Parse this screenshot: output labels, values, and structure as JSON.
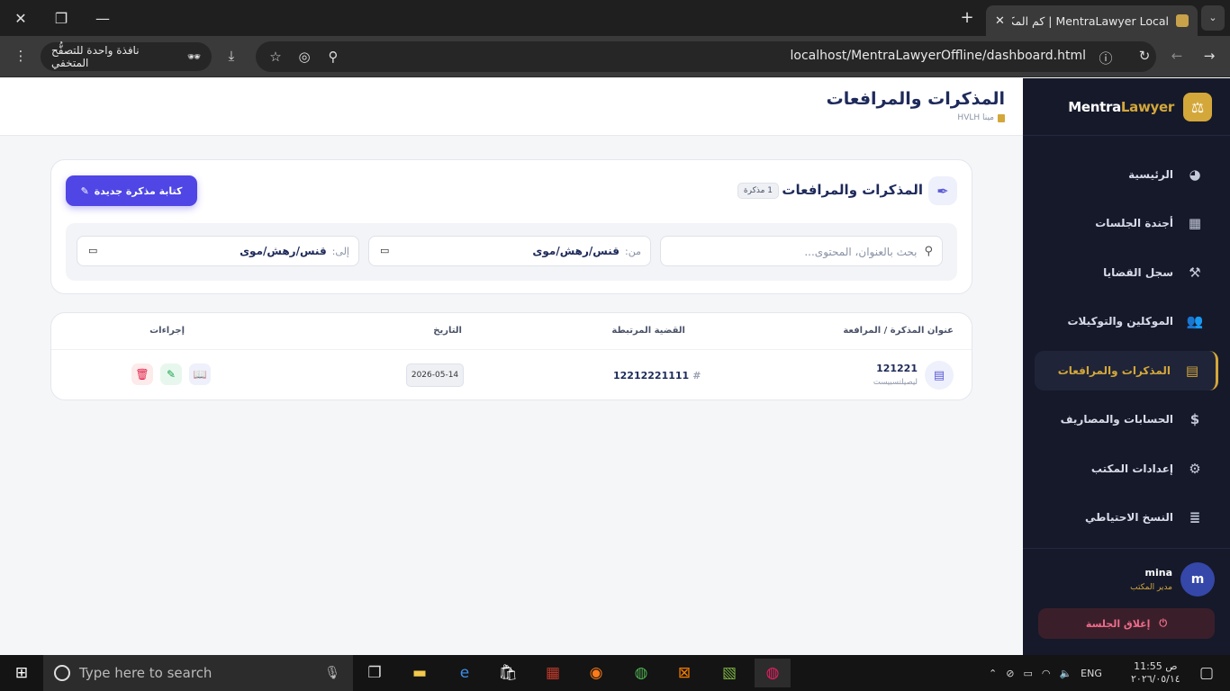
{
  "browser": {
    "tab_title": "MentraLawyer Local | كم المكتب",
    "url": "localhost/MentraLawyerOffline/dashboard.html",
    "incognito_label": "نافذة واحدة للتصفُّح المتخفي",
    "icons": [
      "close-icon",
      "restore-icon",
      "minimize-icon",
      "new-tab-icon",
      "tab-search-icon",
      "menu-icon",
      "download-icon",
      "star-icon",
      "reader-icon",
      "zoom-icon",
      "info-icon",
      "reload-icon",
      "back-icon",
      "forward-icon"
    ]
  },
  "header": {
    "title": "المذكرات والمرافعات",
    "subtitle": "مينا HVLH"
  },
  "memos_card": {
    "title": "المذكرات والمرافعات",
    "count_badge": "1 مذكرة",
    "new_button": "كتابة مذكرة جديدة",
    "search_placeholder": "بحث بالعنوان، المحتوى...",
    "from_label": "من:",
    "from_value": "قنس/رهش/موى",
    "to_label": "إلى:",
    "to_value": "قنس/رهش/موى"
  },
  "table": {
    "headers": {
      "title": "عنوان المذكرة / المرافعة",
      "case": "القضية المرتبطة",
      "date": "التاريخ",
      "actions": "إجراءات"
    },
    "rows": [
      {
        "title": "121221",
        "subtitle": "ليصيلتسبيست",
        "case": "12212221111",
        "date": "2026-05-14"
      }
    ]
  },
  "sidebar": {
    "brand_main": "Mentra",
    "brand_accent": "Lawyer",
    "items": [
      {
        "label": "الرئيسية",
        "icon": "pie-chart-icon"
      },
      {
        "label": "أجندة الجلسات",
        "icon": "calendar-icon"
      },
      {
        "label": "سجل القضايا",
        "icon": "gavel-icon"
      },
      {
        "label": "الموكلين والتوكيلات",
        "icon": "users-icon"
      },
      {
        "label": "المذكرات والمرافعات",
        "icon": "file-contract-icon"
      },
      {
        "label": "الحسابات والمصاريف",
        "icon": "invoice-icon"
      },
      {
        "label": "إعدادات المكتب",
        "icon": "gear-icon"
      },
      {
        "label": "النسخ الاحتياطي",
        "icon": "database-icon"
      }
    ],
    "user": {
      "initial": "m",
      "name": "mina",
      "role": "مدير المكتب"
    },
    "logout": "إغلاق الجلسة"
  },
  "taskbar": {
    "search_placeholder": "Type here to search",
    "lang": "ENG",
    "time": "11:55 ص",
    "date": "٢٠٢٦/٠٥/١٤"
  },
  "colors": {
    "accent": "#4f46e5",
    "brand_gold": "#d4a73a",
    "sidebar_bg": "#15192a",
    "danger": "#e11d48",
    "success": "#16a34a"
  }
}
